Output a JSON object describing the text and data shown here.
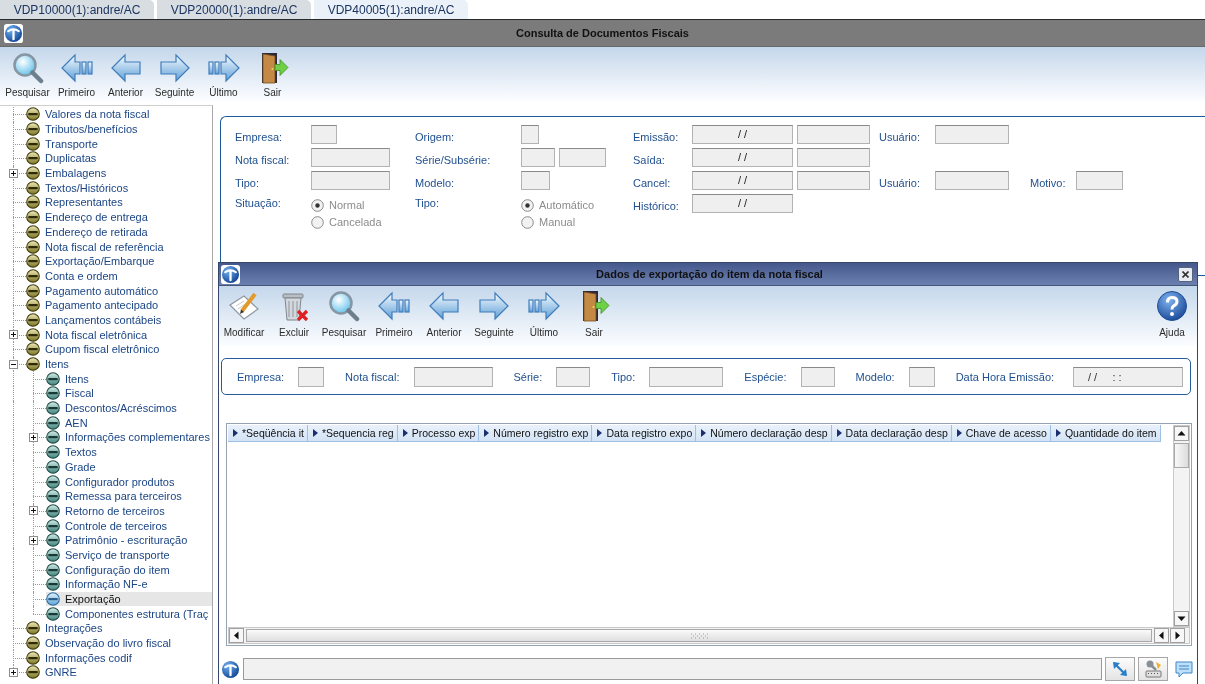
{
  "tabs": [
    {
      "label": "VDP10000(1):andre/AC",
      "selected": false
    },
    {
      "label": "VDP20000(1):andre/AC",
      "selected": false
    },
    {
      "label": "VDP40005(1):andre/AC",
      "selected": true
    }
  ],
  "window": {
    "title": "Consulta de Documentos Fiscais",
    "toolbar": [
      {
        "label": "Pesquisar",
        "kind": "search"
      },
      {
        "label": "Primeiro",
        "kind": "first"
      },
      {
        "label": "Anterior",
        "kind": "previous"
      },
      {
        "label": "Seguinte",
        "kind": "next"
      },
      {
        "label": "Último",
        "kind": "last"
      },
      {
        "label": "Sair",
        "kind": "exit"
      }
    ]
  },
  "tree": [
    {
      "label": "Valores da nota fiscal",
      "selected": false
    },
    {
      "label": "Tributos/benefícios",
      "selected": false
    },
    {
      "label": "Transporte",
      "selected": false
    },
    {
      "label": "Duplicatas",
      "selected": false
    },
    {
      "label": "Embalagens",
      "selected": false,
      "expanded": false
    },
    {
      "label": "Textos/Históricos",
      "selected": false
    },
    {
      "label": "Representantes",
      "selected": false
    },
    {
      "label": "Endereço de entrega",
      "selected": false
    },
    {
      "label": "Endereço de retirada",
      "selected": false
    },
    {
      "label": "Nota fiscal de referência",
      "selected": false
    },
    {
      "label": "Exportação/Embarque",
      "selected": false
    },
    {
      "label": "Conta e ordem",
      "selected": false
    },
    {
      "label": "Pagamento automático",
      "selected": false
    },
    {
      "label": "Pagamento antecipado",
      "selected": false
    },
    {
      "label": "Lançamentos contábeis",
      "selected": false
    },
    {
      "label": "Nota fiscal eletrônica",
      "selected": false,
      "expanded": false
    },
    {
      "label": "Cupom fiscal eletrônico",
      "selected": false
    },
    {
      "label": "Itens",
      "selected": false,
      "expanded": true,
      "children": [
        {
          "label": "Itens",
          "selected": false
        },
        {
          "label": "Fiscal",
          "selected": false
        },
        {
          "label": "Descontos/Acréscimos",
          "selected": false
        },
        {
          "label": "AEN",
          "selected": false
        },
        {
          "label": "Informações complementares",
          "selected": false,
          "expanded": false
        },
        {
          "label": "Textos",
          "selected": false
        },
        {
          "label": "Grade",
          "selected": false
        },
        {
          "label": "Configurador produtos",
          "selected": false
        },
        {
          "label": "Remessa para terceiros",
          "selected": false
        },
        {
          "label": "Retorno de terceiros",
          "selected": false,
          "expanded": false
        },
        {
          "label": "Controle de terceiros",
          "selected": false
        },
        {
          "label": "Patrimônio - escrituração",
          "selected": false,
          "expanded": false
        },
        {
          "label": "Serviço de transporte",
          "selected": false
        },
        {
          "label": "Configuração do item",
          "selected": false
        },
        {
          "label": "Informação NF-e",
          "selected": false
        },
        {
          "label": "Exportação",
          "selected": true
        },
        {
          "label": "Componentes estrutura (Traç",
          "selected": false
        }
      ]
    },
    {
      "label": "Integrações",
      "selected": false
    },
    {
      "label": "Observação do livro fiscal",
      "selected": false
    },
    {
      "label": "Informações codif",
      "selected": false
    },
    {
      "label": "GNRE",
      "selected": false,
      "expanded": false
    }
  ],
  "form": {
    "rows": [
      [
        {
          "label": "Empresa:",
          "inputs": [
            {
              "disabled": true
            }
          ]
        },
        {
          "label": "Origem:",
          "inputs": [
            {
              "disabled": true
            }
          ]
        },
        {
          "label": "Emissão:",
          "inputs": [
            {
              "disabled": true,
              "value": "/ /"
            },
            {
              "disabled": true
            }
          ]
        },
        {
          "label": "Usuário:",
          "inputs": [
            {
              "disabled": true
            }
          ]
        }
      ],
      [
        {
          "label": "Nota fiscal:",
          "inputs": [
            {
              "disabled": true
            }
          ]
        },
        {
          "label": "Série/Subsérie:",
          "inputs": [
            {
              "disabled": true
            },
            {
              "disabled": true
            }
          ]
        },
        {
          "label": "Saída:",
          "inputs": [
            {
              "disabled": true,
              "value": "/ /"
            },
            {
              "disabled": true
            }
          ]
        }
      ],
      [
        {
          "label": "Tipo:",
          "inputs": [
            {
              "disabled": true
            }
          ]
        },
        {
          "label": "Modelo:",
          "inputs": [
            {
              "disabled": true
            }
          ]
        },
        {
          "label": "Cancel:",
          "inputs": [
            {
              "disabled": true,
              "value": "/ /"
            },
            {
              "disabled": true
            }
          ]
        },
        {
          "label": "Usuário:",
          "inputs": [
            {
              "disabled": true
            }
          ]
        },
        {
          "label": "Motivo:",
          "inputs": [
            {
              "disabled": true
            }
          ]
        }
      ],
      [
        {
          "label": "Situação:",
          "options": [
            {
              "label": "Normal",
              "selected": true,
              "disabled": true
            },
            {
              "label": "Cancelada",
              "selected": false,
              "disabled": true
            }
          ]
        },
        {
          "label": "Tipo:",
          "options": [
            {
              "label": "Automático",
              "selected": true,
              "disabled": true
            },
            {
              "label": "Manual",
              "selected": false,
              "disabled": true
            }
          ]
        },
        {
          "label": "Histórico:",
          "inputs": [
            {
              "disabled": true,
              "value": "/ /"
            }
          ]
        }
      ]
    ]
  },
  "dialog": {
    "title": "Dados de exportação do item da nota fiscal",
    "toolbar": [
      {
        "label": "Modificar",
        "kind": "edit"
      },
      {
        "label": "Excluir",
        "kind": "delete"
      },
      {
        "label": "Pesquisar",
        "kind": "search"
      },
      {
        "label": "Primeiro",
        "kind": "first"
      },
      {
        "label": "Anterior",
        "kind": "previous"
      },
      {
        "label": "Seguinte",
        "kind": "next"
      },
      {
        "label": "Último",
        "kind": "last"
      },
      {
        "label": "Sair",
        "kind": "exit"
      },
      {
        "label": "Ajuda",
        "kind": "help"
      }
    ],
    "filters": [
      {
        "label": "Empresa:",
        "inputs": [
          {
            "disabled": true
          }
        ]
      },
      {
        "label": "Nota fiscal:",
        "inputs": [
          {
            "disabled": true
          }
        ]
      },
      {
        "label": "Série:",
        "inputs": [
          {
            "disabled": true
          }
        ]
      },
      {
        "label": "Tipo:",
        "inputs": [
          {
            "disabled": true
          }
        ]
      },
      {
        "label": "Espécie:",
        "inputs": [
          {
            "disabled": true
          }
        ]
      },
      {
        "label": "Modelo:",
        "inputs": [
          {
            "disabled": true
          }
        ]
      },
      {
        "label": "Data Hora Emissão:",
        "inputs": [
          {
            "disabled": true,
            "value": "/ /     : :"
          }
        ]
      }
    ],
    "table": {
      "columns": [
        "*Seqüência it",
        "*Sequencia reg",
        "Processo exp",
        "Número registro exp",
        "Data registro expo",
        "Número declaração desp",
        "Data declaração desp",
        "Chave de acesso",
        "Quantidade do item"
      ]
    }
  }
}
